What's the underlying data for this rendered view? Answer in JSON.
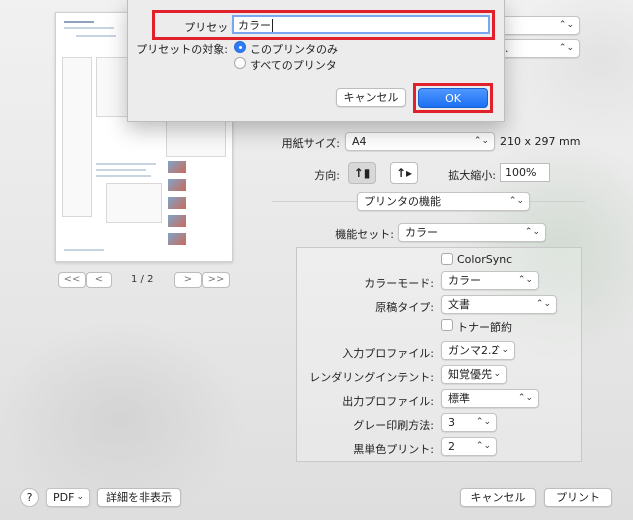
{
  "preset_sheet": {
    "name_label": "プリセット名:",
    "name_value": "カラー",
    "target_label": "プリセットの対象:",
    "options": [
      "このプリンタのみ",
      "すべてのプリンタ"
    ],
    "selected_option": 0,
    "cancel_label": "キャンセル",
    "ok_label": "OK"
  },
  "background_popups": {
    "top_right_1": "",
    "top_right_2": "手..."
  },
  "preview": {
    "page_indicator": "1 / 2",
    "first_label": "<<",
    "prev_label": "<",
    "next_label": ">",
    "last_label": ">>"
  },
  "paper": {
    "label": "用紙サイズ:",
    "value": "A4",
    "dimensions": "210 x 297 mm"
  },
  "orientation": {
    "label": "方向:",
    "scale_label": "拡大縮小:",
    "scale_value": "100%"
  },
  "section_popup": "プリンタの機能",
  "feature_set": {
    "label": "機能セット:",
    "value": "カラー"
  },
  "options": {
    "colorsync_label": "ColorSync",
    "color_mode_label": "カラーモード:",
    "color_mode_value": "カラー",
    "paper_type_label": "原稿タイプ:",
    "paper_type_value": "文書",
    "toner_save_label": "トナー節約",
    "input_profile_label": "入力プロファイル:",
    "input_profile_value": "ガンマ2.2",
    "rendering_intent_label": "レンダリングインテント:",
    "rendering_intent_value": "知覚優先",
    "output_profile_label": "出力プロファイル:",
    "output_profile_value": "標準",
    "gray_method_label": "グレー印刷方法:",
    "gray_method_value": "3",
    "black_print_label": "黒単色プリント:",
    "black_print_value": "2"
  },
  "footer": {
    "help_label": "?",
    "pdf_label": "PDF",
    "hide_details_label": "詳細を非表示",
    "cancel_label": "キャンセル",
    "print_label": "プリント"
  },
  "colors": {
    "accent": "#2f7bf5",
    "highlight_frame": "#e0202b"
  }
}
